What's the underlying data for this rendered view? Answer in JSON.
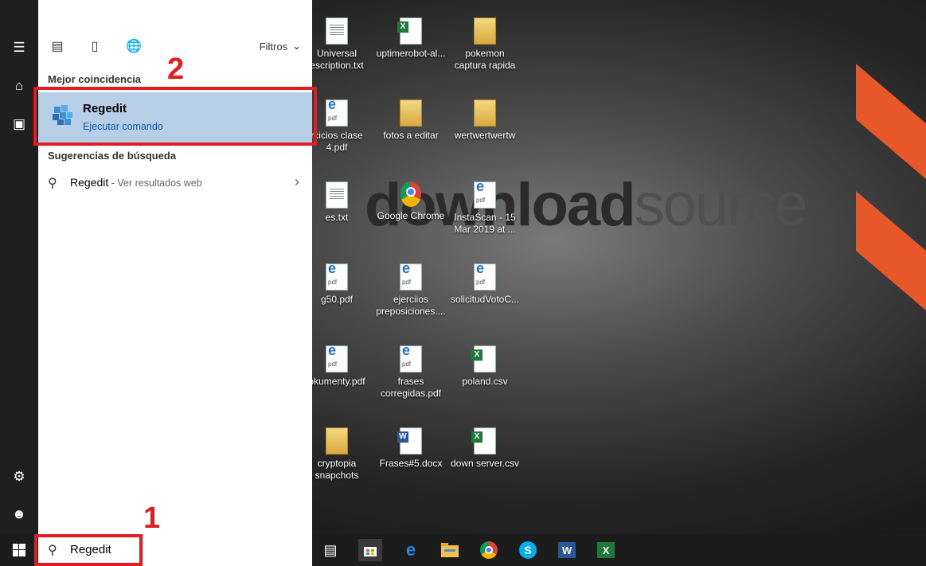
{
  "desktop": {
    "watermark": {
      "bold": "download",
      "light": "source"
    },
    "icons": [
      {
        "label": "Universal\nescription.txt",
        "type": "doc"
      },
      {
        "label": "uptimerobot-al...",
        "type": "xls"
      },
      {
        "label": "pokemon\ncaptura rapida",
        "type": "folder"
      },
      {
        "label": "rcicios clase\n4.pdf",
        "type": "pdf"
      },
      {
        "label": "fotos a editar",
        "type": "folder"
      },
      {
        "label": "wertwertwertw",
        "type": "folder"
      },
      {
        "label": "es.txt",
        "type": "doc"
      },
      {
        "label": "Google Chrome",
        "type": "chrome"
      },
      {
        "label": "InstaScan - 15\nMar 2019 at ...",
        "type": "pdf"
      },
      {
        "label": "g50.pdf",
        "type": "pdf"
      },
      {
        "label": "ejerciios\npreposiciones....",
        "type": "pdf"
      },
      {
        "label": "solicitudVotoC...",
        "type": "pdf"
      },
      {
        "label": "okumenty.pdf",
        "type": "pdf"
      },
      {
        "label": "frases\ncorregidas.pdf",
        "type": "pdf"
      },
      {
        "label": "poland.csv",
        "type": "xls"
      },
      {
        "label": "cryptopia\nsnapchots",
        "type": "folder"
      },
      {
        "label": "Frases#5.docx",
        "type": "word"
      },
      {
        "label": "down server.csv",
        "type": "xls"
      }
    ]
  },
  "rail": {
    "items": [
      "hamburger-icon",
      "home-icon",
      "documents-icon",
      "settings-icon",
      "user-icon"
    ]
  },
  "search_panel": {
    "toolbar": {
      "filters_label": "Filtros"
    },
    "best_match_title": "Mejor coincidencia",
    "best_match": {
      "name": "Regedit",
      "subtitle": "Ejecutar comando"
    },
    "suggestions_title": "Sugerencias de búsqueda",
    "suggestion": {
      "term": "Regedit",
      "suffix": " - Ver resultados web"
    }
  },
  "taskbar": {
    "search_value": "Regedit",
    "apps": [
      "task-view-icon",
      "store-icon",
      "edge-icon",
      "file-explorer-icon",
      "chrome-icon",
      "skype-icon",
      "word-icon",
      "excel-icon"
    ]
  },
  "annotations": {
    "step1": "1",
    "step2": "2"
  },
  "colors": {
    "highlight": "#b6cfe6",
    "annotation": "#e31b23",
    "accent_orange": "#e8572a"
  }
}
